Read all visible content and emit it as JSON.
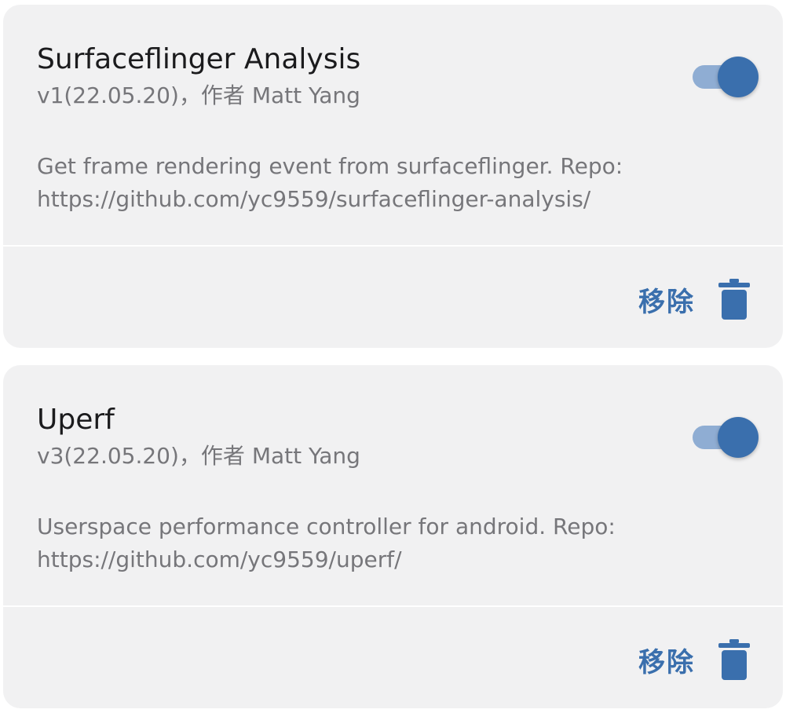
{
  "modules": [
    {
      "title": "Surfaceflinger Analysis",
      "meta": "v1(22.05.20)，作者 Matt Yang",
      "description": "Get frame rendering event from surfaceflinger. Repo: https://github.com/yc9559/surfaceflinger-analysis/",
      "enabled": true,
      "remove_label": "移除"
    },
    {
      "title": "Uperf",
      "meta": "v3(22.05.20)，作者 Matt Yang",
      "description": "Userspace performance controller for android. Repo: https://github.com/yc9559/uperf/",
      "enabled": true,
      "remove_label": "移除"
    }
  ],
  "colors": {
    "accent": "#3a6fad",
    "toggle_track": "#8fadd3",
    "card_background": "#f1f1f2",
    "title_text": "#1b1b1d",
    "secondary_text": "#76767a"
  },
  "icons": {
    "remove": "trash-icon"
  }
}
